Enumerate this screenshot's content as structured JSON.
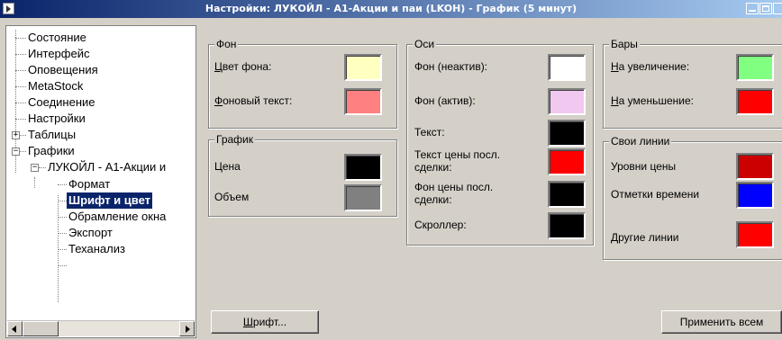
{
  "window": {
    "title": "Настройки: ЛУКОЙЛ - А1-Акции и паи (LKOH) - График (5 минут)"
  },
  "tree": {
    "items": [
      {
        "label": "Состояние",
        "level": 0
      },
      {
        "label": "Интерфейс",
        "level": 0
      },
      {
        "label": "Оповещения",
        "level": 0
      },
      {
        "label": "MetaStock",
        "level": 0
      },
      {
        "label": "Соединение",
        "level": 0
      },
      {
        "label": "Настройки",
        "level": 0
      },
      {
        "label": "Таблицы",
        "level": 0,
        "expander": "+"
      },
      {
        "label": "Графики",
        "level": 0,
        "expander": "−"
      },
      {
        "label": "ЛУКОЙЛ - А1-Акции и",
        "level": 1,
        "expander": "−"
      },
      {
        "label": "Формат",
        "level": 2
      },
      {
        "label": "Шрифт и цвет",
        "level": 2,
        "selected": true
      },
      {
        "label": "Обрамление окна",
        "level": 2
      },
      {
        "label": "Экспорт",
        "level": 2
      },
      {
        "label": "Теханализ",
        "level": 2
      }
    ]
  },
  "groups": {
    "fon": {
      "title": "Фон",
      "bg_color_label_u": "Ц",
      "bg_color_label": "вет фона:",
      "bg_color": "#ffffc0",
      "bg_text_label_u": "Ф",
      "bg_text_label": "оновый текст:",
      "bg_text_color": "#ff8080"
    },
    "grafik": {
      "title": "График",
      "price_label": "Цена",
      "price_color": "#000000",
      "volume_label": "Объем",
      "volume_color": "#808080"
    },
    "osi": {
      "title": "Оси",
      "inactive_label": "Фон (неактив):",
      "inactive_color": "#ffffff",
      "active_label": "Фон (актив):",
      "active_color": "#f0c8f0",
      "text_label": "Текст:",
      "text_color": "#000000",
      "last_price_text_label": "Текст цены посл. сделки:",
      "last_price_text_color": "#ff0000",
      "last_price_bg_label": "Фон цены посл. сделки:",
      "last_price_bg_color": "#000000",
      "scroller_label": "Скроллер:",
      "scroller_color": "#000000"
    },
    "bary": {
      "title": "Бары",
      "up_label_u": "Н",
      "up_label": "а увеличение:",
      "up_color": "#80ff80",
      "down_label_u": "Н",
      "down_label": "а уменьшение:",
      "down_color": "#ff0000"
    },
    "lines": {
      "title": "Свои линии",
      "price_levels_label": "Уровни цены",
      "price_levels_color": "#cc0000",
      "time_marks_label": "Отметки времени",
      "time_marks_color": "#0000ff",
      "other_lines_label": "Другие линии",
      "other_lines_color": "#ff0000"
    }
  },
  "buttons": {
    "font_u": "Ш",
    "font": "рифт...",
    "apply_all": "Применить всем"
  },
  "icons": {
    "system": "app-menu-icon",
    "minimize": "minimize-icon",
    "maximize": "maximize-icon",
    "close": "close-icon"
  }
}
